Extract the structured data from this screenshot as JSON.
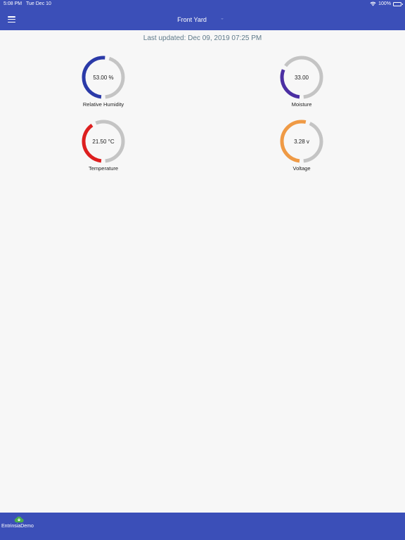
{
  "status_bar": {
    "time": "5:08 PM",
    "date": "Tue Dec 10",
    "battery": "100%"
  },
  "header": {
    "title": "Front Yard"
  },
  "last_updated": "Last updated: Dec 09, 2019 07:25 PM",
  "gauges": [
    {
      "label": "Relative Humidity",
      "value_text": "53.00 %",
      "fraction": 0.53,
      "color": "#2b3aa8"
    },
    {
      "label": "Moisture",
      "value_text": "33.00",
      "fraction": 0.33,
      "color": "#4b2fa3"
    },
    {
      "label": "Temperature",
      "value_text": "21.50 °C",
      "fraction": 0.42,
      "color": "#dd1f1f"
    },
    {
      "label": "Voltage",
      "value_text": "3.28 v",
      "fraction": 0.55,
      "color": "#ef9a45"
    }
  ],
  "colors": {
    "primary": "#3b4fb8",
    "track": "#c4c4c4",
    "cloud": "#4caf50"
  },
  "bottom_tab": {
    "label": "EntrinsiaDemo",
    "icon": "cloud-download-icon"
  }
}
